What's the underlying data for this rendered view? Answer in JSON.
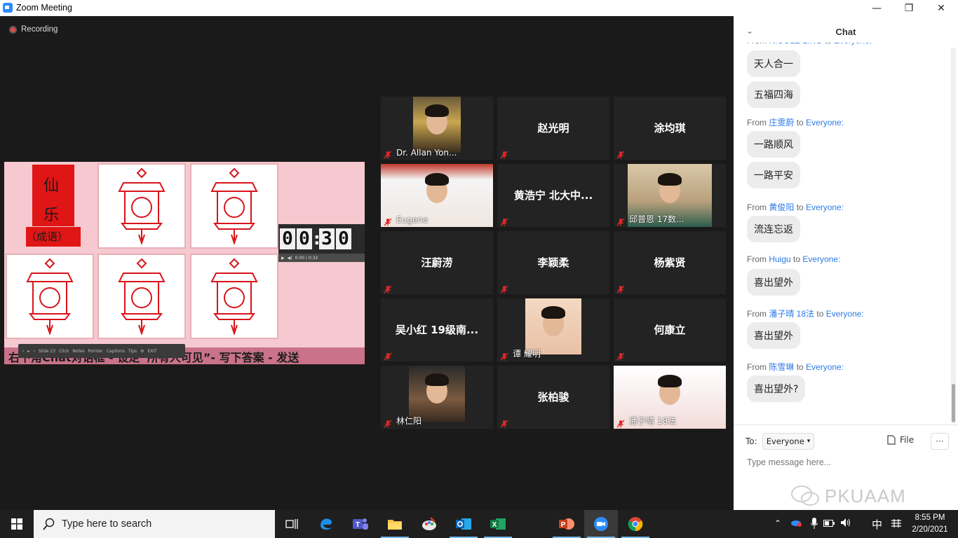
{
  "window": {
    "title": "Zoom Meeting",
    "minimize": "—",
    "maximize": "❐",
    "close": "✕"
  },
  "recording": {
    "label": "Recording"
  },
  "slide": {
    "chars": [
      "仙",
      "乐"
    ],
    "subtitle": "（成语）",
    "timer_digits": [
      "0",
      "0",
      "3",
      "0"
    ],
    "timer_controls": "0:00 / 0:32",
    "caption": "右下角Chat对话框 - 设定“所有人可见”- 写下答案 - 发送",
    "toolbar": {
      "slide_label": "Slide 23",
      "items": [
        "Click",
        "Notes",
        "Pointer",
        "Captions",
        "Tips",
        "EXIT"
      ]
    }
  },
  "participants": [
    {
      "name": "Dr. Allan Yon...",
      "video": true
    },
    {
      "name": "赵光明",
      "video": false
    },
    {
      "name": "涂均琪",
      "video": false
    },
    {
      "name": "Eugene",
      "video": true
    },
    {
      "name": "黄浩宁 北大中...",
      "video": false
    },
    {
      "name": "邱普恩 17数...",
      "video": true
    },
    {
      "name": "汪蔚涝",
      "video": false
    },
    {
      "name": "李颖柔",
      "video": false
    },
    {
      "name": "杨紫贤",
      "video": false
    },
    {
      "name": "吴小红 19级南...",
      "video": false
    },
    {
      "name": "谭 耀明",
      "video": true
    },
    {
      "name": "何康立",
      "video": false
    },
    {
      "name": "林仁阳",
      "video": true
    },
    {
      "name": "张柏骏",
      "video": false
    },
    {
      "name": "潘子晴 18法",
      "video": true
    }
  ],
  "chat": {
    "title": "Chat",
    "messages": [
      {
        "from": "NICOLE LING",
        "to": "Everyone:",
        "texts": [
          "天人合一",
          "五福四海"
        ]
      },
      {
        "from": "庄雯蔚",
        "to": "Everyone:",
        "texts": [
          "一路顺风",
          "一路平安"
        ]
      },
      {
        "from": "黄俊阳",
        "to": "Everyone:",
        "texts": [
          "流连忘返"
        ]
      },
      {
        "from": "Huigu",
        "to": "Everyone:",
        "texts": [
          "喜出望外"
        ]
      },
      {
        "from": "潘子晴 18法",
        "to": "Everyone:",
        "texts": [
          "喜出望外"
        ]
      },
      {
        "from": "陈雪琳",
        "to": "Everyone:",
        "texts": [
          "喜出望外?"
        ]
      }
    ],
    "from_word": "From",
    "to_word": "to",
    "to_label": "To:",
    "to_value": "Everyone",
    "file_label": "File",
    "more_label": "···",
    "input_placeholder": "Type message here...",
    "watermark": "PKUAAM"
  },
  "taskbar": {
    "search_placeholder": "Type here to search",
    "apps": [
      "task-view",
      "edge",
      "teams",
      "file-explorer",
      "paint",
      "outlook",
      "excel",
      "powerpoint",
      "zoom",
      "chrome"
    ],
    "ime": "中",
    "time": "8:55 PM",
    "date": "2/20/2021"
  }
}
